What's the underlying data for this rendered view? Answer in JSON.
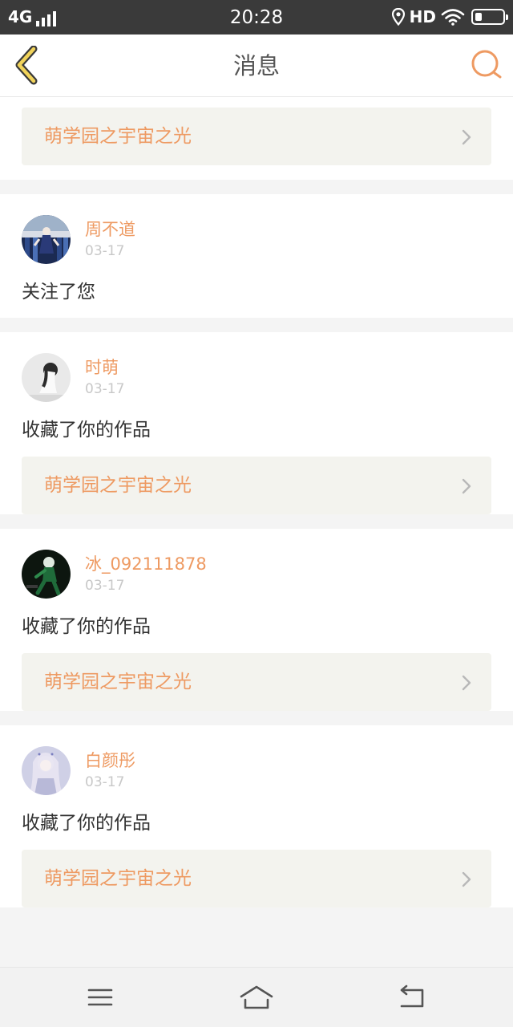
{
  "status_bar": {
    "network": "4G",
    "time": "20:28",
    "hd": "HD",
    "battery_level": 0.25,
    "icons": [
      "signal-icon",
      "location-icon",
      "wifi-icon",
      "battery-icon"
    ]
  },
  "header": {
    "title": "消息",
    "back_icon": "chevron-left-icon",
    "search_icon": "search-icon"
  },
  "colors": {
    "accent": "#ee9a62",
    "back_icon_fill": "#f1d35a",
    "card_link_bg": "#f3f3ee",
    "date": "#c8c8c8"
  },
  "top_card": {
    "work_title": "萌学园之宇宙之光"
  },
  "notifications": [
    {
      "username": "周不道",
      "date": "03-17",
      "action": "关注了您",
      "work_title": ""
    },
    {
      "username": "时萌",
      "date": "03-17",
      "action": "收藏了你的作品",
      "work_title": "萌学园之宇宙之光"
    },
    {
      "username": "冰_092111878",
      "date": "03-17",
      "action": "收藏了你的作品",
      "work_title": "萌学园之宇宙之光"
    },
    {
      "username": "白颜彤",
      "date": "03-17",
      "action": "收藏了你的作品",
      "work_title": "萌学园之宇宙之光"
    }
  ],
  "system_nav": {
    "icons": [
      "menu-icon",
      "home-icon",
      "back-icon"
    ]
  }
}
